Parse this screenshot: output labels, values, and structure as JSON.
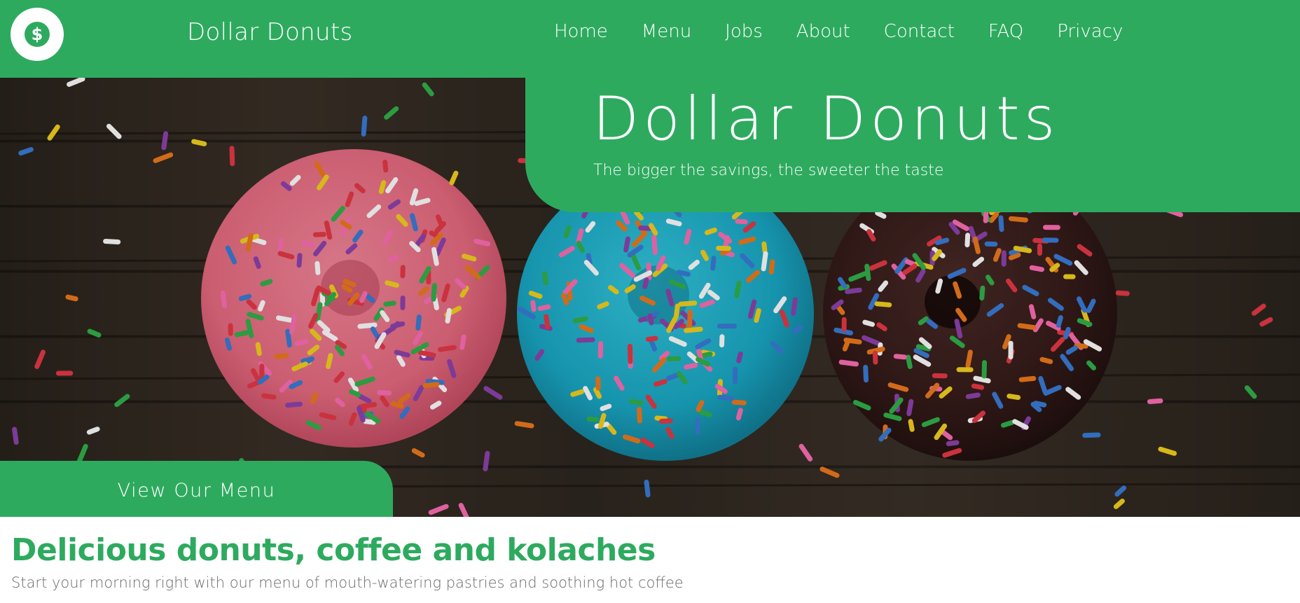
{
  "header": {
    "brand": "Dollar Donuts",
    "logo_icon": "dollar-coin-icon",
    "nav": [
      "Home",
      "Menu",
      "Jobs",
      "About",
      "Contact",
      "FAQ",
      "Privacy"
    ]
  },
  "hero": {
    "title": "Dollar Donuts",
    "subtitle": "The bigger the savings, the sweeter the taste",
    "cta_label": "View Our Menu",
    "image": "three sprinkled donuts (pink, blue, chocolate) on dark wood table"
  },
  "intro": {
    "heading": "Delicious donuts, coffee and kolaches",
    "text": "Start your morning right with our menu of mouth-watering pastries and soothing hot coffee"
  },
  "colors": {
    "brand_green": "#2eaa5f",
    "white": "#ffffff",
    "body_text": "#6a6a6a"
  }
}
